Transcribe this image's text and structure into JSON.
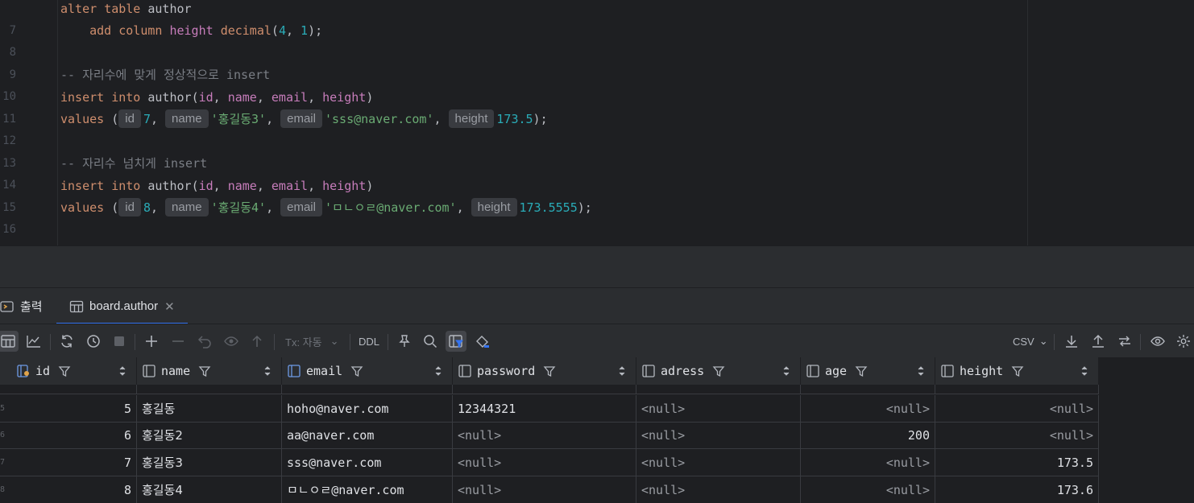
{
  "editor": {
    "lines": [
      {
        "num": "7"
      },
      {
        "num": "8"
      },
      {
        "num": "9"
      },
      {
        "num": "10"
      },
      {
        "num": "11"
      },
      {
        "num": "12"
      },
      {
        "num": "13"
      },
      {
        "num": "14"
      },
      {
        "num": "15"
      },
      {
        "num": "16"
      }
    ],
    "l7": {
      "kw1": "alter",
      "kw2": "table",
      "name": "author"
    },
    "l8": {
      "kw1": "add",
      "kw2": "column",
      "col": "height",
      "type": "decimal",
      "p1": "4",
      "p2": "1"
    },
    "l10": {
      "comment": "-- 자리수에 맞게 정상적으로 insert"
    },
    "l11": {
      "kw1": "insert",
      "kw2": "into",
      "table": "author",
      "c1": "id",
      "c2": "name",
      "c3": "email",
      "c4": "height"
    },
    "l12": {
      "kw": "values",
      "h1": "id",
      "v1": "7",
      "h2": "name",
      "v2": "'홍길동3'",
      "h3": "email",
      "v3": "'sss@naver.com'",
      "h4": "height",
      "v4": "173.5"
    },
    "l14": {
      "comment": "-- 자리수 넘치게 insert"
    },
    "l15": {
      "kw1": "insert",
      "kw2": "into",
      "table": "author",
      "c1": "id",
      "c2": "name",
      "c3": "email",
      "c4": "height"
    },
    "l16": {
      "kw": "values",
      "h1": "id",
      "v1": "8",
      "h2": "name",
      "v2": "'홍길동4'",
      "h3": "email",
      "v3": "'ㅁㄴㅇㄹ@naver.com'",
      "h4": "height",
      "v4": "173.5555"
    }
  },
  "tabs": [
    {
      "label": "출력",
      "icon": "output-icon"
    },
    {
      "label": "board.author",
      "icon": "table-icon",
      "active": true
    }
  ],
  "toolbar": {
    "tx_label": "Tx: 자동",
    "ddl_label": "DDL",
    "export_format": "CSV"
  },
  "grid": {
    "columns": [
      {
        "name": "id",
        "icon": "primary-key-column-icon"
      },
      {
        "name": "name",
        "icon": "column-icon"
      },
      {
        "name": "email",
        "icon": "unique-column-icon"
      },
      {
        "name": "password",
        "icon": "column-icon"
      },
      {
        "name": "adress",
        "icon": "column-icon"
      },
      {
        "name": "age",
        "icon": "column-icon"
      },
      {
        "name": "height",
        "icon": "column-icon"
      }
    ],
    "rows": [
      {
        "id": "5",
        "name": "홍길동",
        "email": "hoho@naver.com",
        "password": "12344321",
        "adress": "<null>",
        "age": "<null>",
        "height": "<null>"
      },
      {
        "id": "6",
        "name": "홍길동2",
        "email": "aa@naver.com",
        "password": "<null>",
        "adress": "<null>",
        "age": "200",
        "height": "<null>"
      },
      {
        "id": "7",
        "name": "홍길동3",
        "email": "sss@naver.com",
        "password": "<null>",
        "adress": "<null>",
        "age": "<null>",
        "height": "173.5"
      },
      {
        "id": "8",
        "name": "홍길동4",
        "email": "ㅁㄴㅇㄹ@naver.com",
        "password": "<null>",
        "adress": "<null>",
        "age": "<null>",
        "height": "173.6"
      }
    ],
    "row_numbers": [
      "5",
      "6",
      "7",
      "8"
    ]
  }
}
